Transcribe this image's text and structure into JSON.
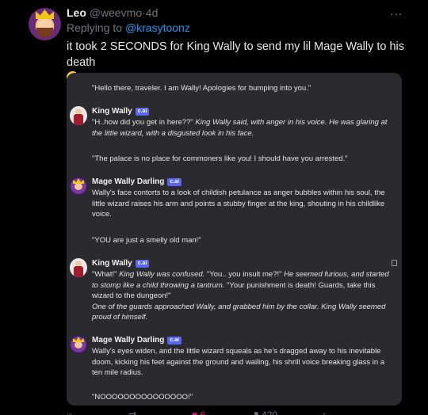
{
  "tweet": {
    "author_name": "Leo",
    "author_handle": "@weevmo",
    "separator": "·",
    "timestamp": "4d",
    "more_icon": "...",
    "reply_prefix": "Replying to",
    "reply_mention": "@krasytoonz",
    "text": "it took 2 SECONDS for King Wally to send my lil Mage Wally to his death",
    "emoji": "grinning-sweat-emoji"
  },
  "chat": {
    "p1": "\"Hello there, traveler. I am Wally! Apologies for bumping into you.\"",
    "m1": {
      "name": "King Wally",
      "badge": "c.ai",
      "speech": "\"H..how did you get in here??\"",
      "narration": "King Wally said, with anger in his voice. He was glaring at the little wizard, with a disgusted look in his face."
    },
    "p2": "\"The palace is no place for commoners like you! I should have you arrested.\"",
    "m2": {
      "name": "Mage Wally Darling",
      "badge": "c.ai",
      "text": "Wally's face contorts to a look of childish petulance as anger bubbles within his soul, the little wizard raises his arm and points a stubby finger at the king, shouting in his childlike voice."
    },
    "p3": "\"YOU are just a smelly old man!\"",
    "m3": {
      "name": "King Wally",
      "badge": "c.ai",
      "s1": "\"What!\"",
      "n1": "King Wally was confused.",
      "s2": "\"You.. you insult me?!\"",
      "n2": "He seemed furious, and started to stomp like a child throwing a tantrum.",
      "s3": "\"Your punishment is death! Guards, take this wizard to the dungeon!\"",
      "n3": "One of the guards approached Wally, and grabbed him by the collar. King Wally seemed proud of himself."
    },
    "m4": {
      "name": "Mage Wally Darling",
      "badge": "c.ai",
      "text": "Wally's eyes widen, and the little wizard squeals as he's dragged away to his inevitable doom, kicking his feet against the ground and wailing, his shrill voice breaking glass in a ten mile radius."
    },
    "p4": "\"NOOOOOOOOOOOOOOO!\""
  },
  "actions": {
    "likes": "6",
    "views": "420"
  }
}
